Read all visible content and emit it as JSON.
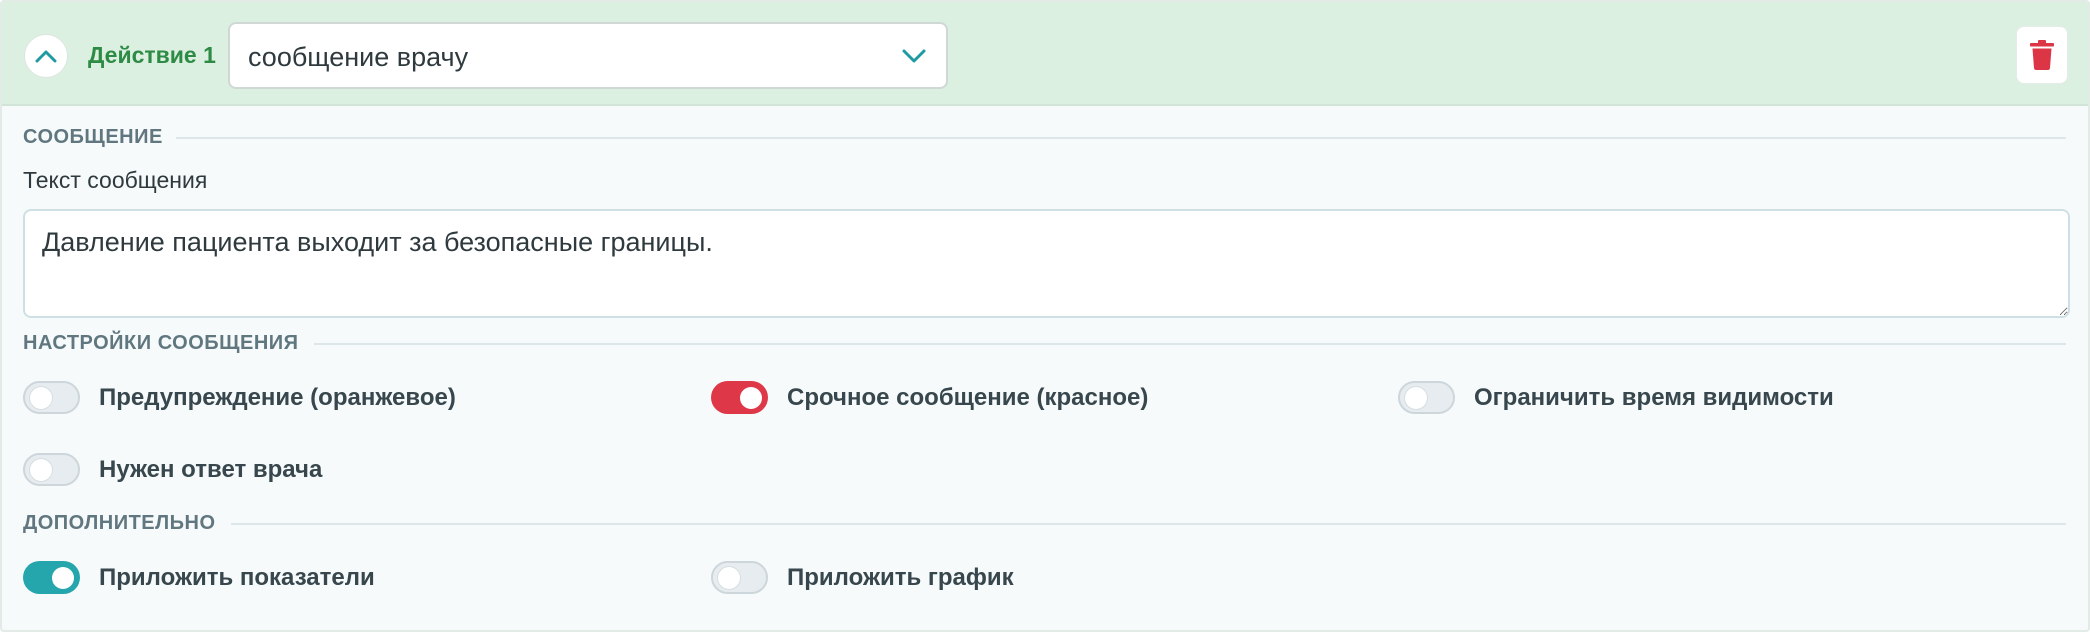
{
  "header": {
    "action_title": "Действие 1",
    "select_value": "сообщение врачу",
    "colors": {
      "header_bg": "#dcf0e2",
      "title": "#2e8b45",
      "delete": "#dc3545"
    }
  },
  "message_section": {
    "title": "СООБЩЕНИЕ",
    "text_label": "Текст сообщения",
    "text_value": "Давление пациента выходит за безопасные границы."
  },
  "settings_section": {
    "title": "НАСТРОЙКИ СООБЩЕНИЯ",
    "toggles": [
      {
        "label": "Предупреждение (оранжевое)",
        "checked": false
      },
      {
        "label": "Срочное сообщение (красное)",
        "checked": true,
        "color": "#de3848"
      },
      {
        "label": "Ограничить время видимости",
        "checked": false
      },
      {
        "label": "Нужен ответ врача",
        "checked": false
      }
    ]
  },
  "extra_section": {
    "title": "ДОПОЛНИТЕЛЬНО",
    "toggles": [
      {
        "label": "Приложить показатели",
        "checked": true,
        "color": "#25a6ac"
      },
      {
        "label": "Приложить график",
        "checked": false
      }
    ]
  },
  "icons": {
    "collapse": "chevron-up-icon",
    "select": "chevron-down-icon",
    "delete": "trash-icon"
  }
}
